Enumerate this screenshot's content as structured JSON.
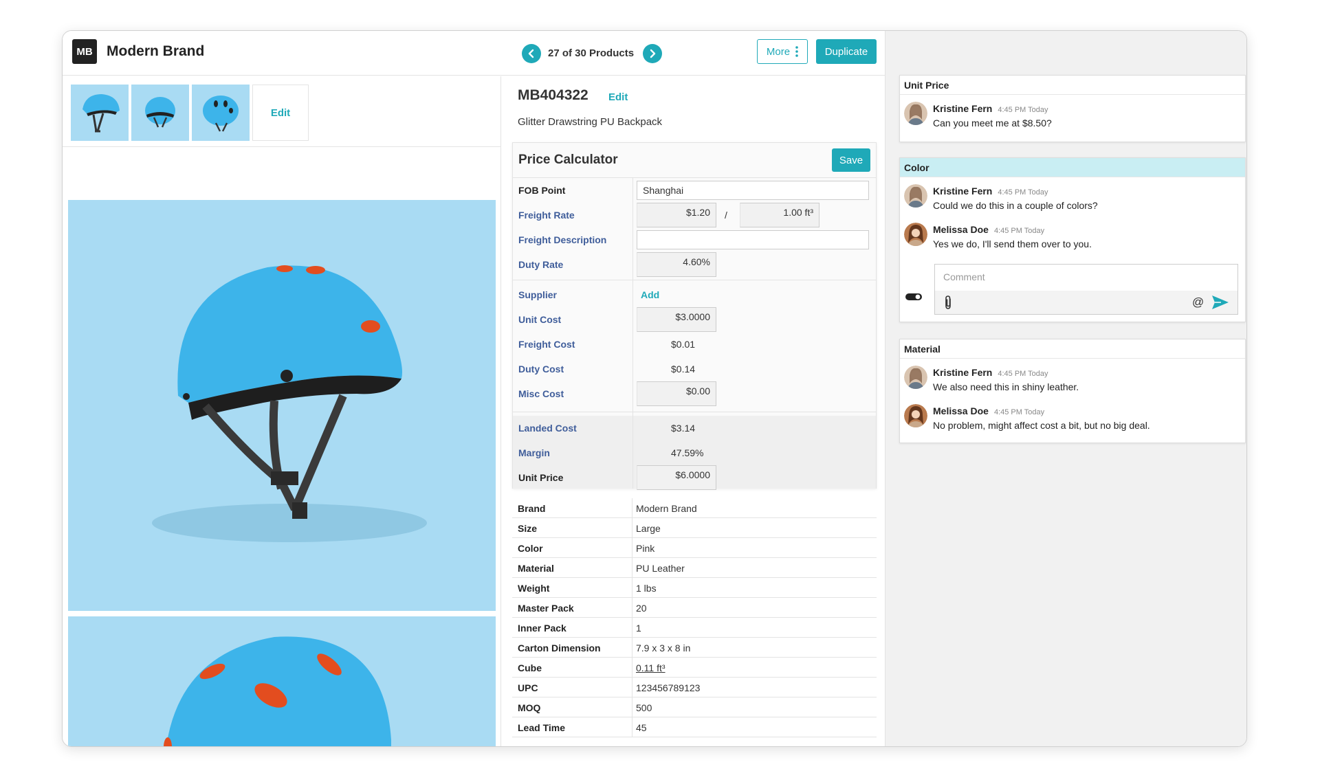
{
  "header": {
    "logo_text": "MB",
    "brand_name": "Modern Brand",
    "nav_count": "27 of 30 Products",
    "more_label": "More",
    "duplicate_label": "Duplicate"
  },
  "gallery": {
    "edit_label": "Edit"
  },
  "product": {
    "sku": "MB404322",
    "sku_edit_label": "Edit",
    "name": "Glitter Drawstring PU Backpack"
  },
  "calculator": {
    "title": "Price Calculator",
    "save_label": "Save",
    "fob_point_label": "FOB Point",
    "fob_point_value": "Shanghai",
    "freight_rate_label": "Freight Rate",
    "freight_rate_value": "$1.20",
    "freight_rate_slash": "/",
    "freight_rate_unit_value": "1.00 ft³",
    "freight_description_label": "Freight Description",
    "freight_description_value": "",
    "duty_rate_label": "Duty Rate",
    "duty_rate_value": "4.60%",
    "supplier_label": "Supplier",
    "supplier_add_label": "Add",
    "unit_cost_label": "Unit Cost",
    "unit_cost_value": "$3.0000",
    "freight_cost_label": "Freight Cost",
    "freight_cost_value": "$0.01",
    "duty_cost_label": "Duty Cost",
    "duty_cost_value": "$0.14",
    "misc_cost_label": "Misc Cost",
    "misc_cost_value": "$0.00",
    "landed_cost_label": "Landed Cost",
    "landed_cost_value": "$3.14",
    "margin_label": "Margin",
    "margin_value": "47.59%",
    "unit_price_label": "Unit Price",
    "unit_price_value": "$6.0000"
  },
  "specs": [
    {
      "label": "Brand",
      "value": "Modern Brand"
    },
    {
      "label": "Size",
      "value": "Large"
    },
    {
      "label": "Color",
      "value": "Pink"
    },
    {
      "label": "Material",
      "value": "PU Leather"
    },
    {
      "label": "Weight",
      "value": "1 lbs"
    },
    {
      "label": "Master Pack",
      "value": "20"
    },
    {
      "label": "Inner Pack",
      "value": "1"
    },
    {
      "label": "Carton Dimension",
      "value": "7.9 x 3 x 8 in"
    },
    {
      "label": "Cube",
      "value": "0.11 ft³"
    },
    {
      "label": "UPC",
      "value": "123456789123"
    },
    {
      "label": "MOQ",
      "value": "500"
    },
    {
      "label": "Lead Time",
      "value": "45"
    }
  ],
  "comments": {
    "unit_price": {
      "title": "Unit Price",
      "items": [
        {
          "name": "Kristine Fern",
          "time": "4:45 PM Today",
          "text": "Can you meet me at $8.50?"
        }
      ]
    },
    "color": {
      "title": "Color",
      "items": [
        {
          "name": "Kristine Fern",
          "time": "4:45 PM Today",
          "text": "Could we do this in a couple of colors?"
        },
        {
          "name": "Melissa Doe",
          "time": "4:45 PM Today",
          "text": "Yes we do, I'll send them over to you."
        }
      ],
      "comment_placeholder": "Comment",
      "mention_symbol": "@"
    },
    "material": {
      "title": "Material",
      "items": [
        {
          "name": "Kristine Fern",
          "time": "4:45 PM Today",
          "text": "We also need this in shiny leather."
        },
        {
          "name": "Melissa Doe",
          "time": "4:45 PM Today",
          "text": "No problem, might affect cost a bit, but no big deal."
        }
      ]
    }
  },
  "colors": {
    "accent": "#1fa9b8",
    "label_link": "#3f5d9a",
    "image_bg": "#a9dbf3",
    "helmet": "#3db4ea",
    "active_card_header": "#c9eef3"
  }
}
